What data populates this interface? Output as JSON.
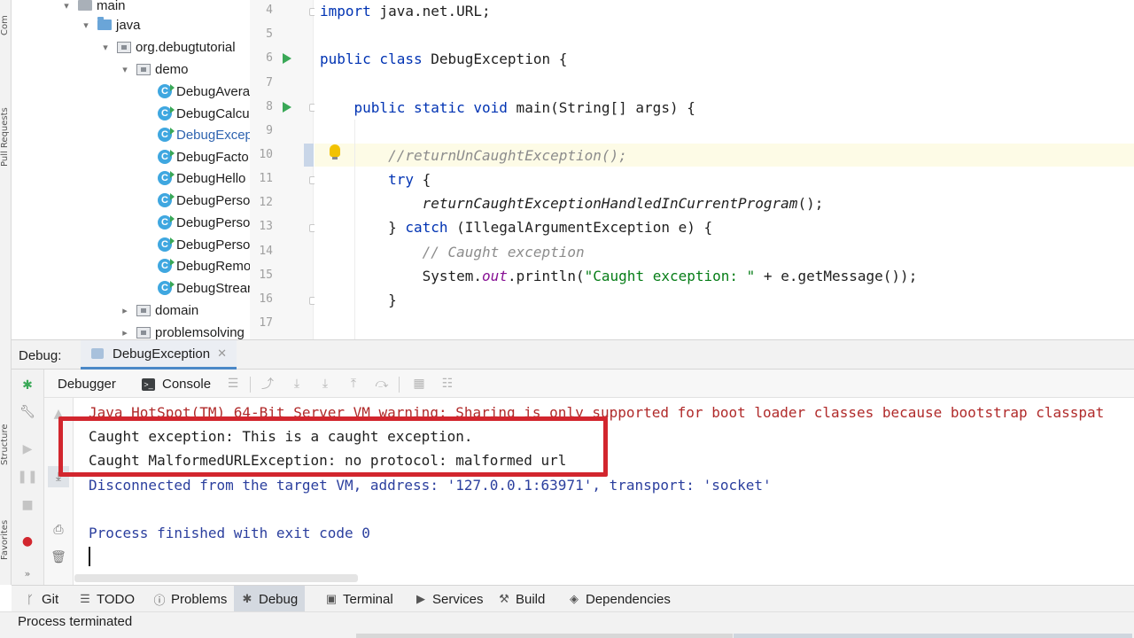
{
  "left_strip": {
    "labels": [
      "Com",
      "Pull Requests",
      "Structure",
      "Favorites"
    ]
  },
  "tree": {
    "items": [
      {
        "label": "main",
        "kind": "folder",
        "expanded": true,
        "selected": false
      },
      {
        "label": "java",
        "kind": "folder-blue",
        "expanded": true,
        "selected": false
      },
      {
        "label": "org.debugtutorial",
        "kind": "package",
        "expanded": true,
        "selected": false
      },
      {
        "label": "demo",
        "kind": "package",
        "expanded": true,
        "selected": false
      },
      {
        "label": "DebugAvera",
        "kind": "class",
        "selected": false
      },
      {
        "label": "DebugCalcu",
        "kind": "class",
        "selected": false
      },
      {
        "label": "DebugExcep",
        "kind": "class",
        "selected": true
      },
      {
        "label": "DebugFacto",
        "kind": "class",
        "selected": false
      },
      {
        "label": "DebugHello",
        "kind": "class",
        "selected": false
      },
      {
        "label": "DebugPerso",
        "kind": "class",
        "selected": false
      },
      {
        "label": "DebugPerso",
        "kind": "class",
        "selected": false
      },
      {
        "label": "DebugPerso",
        "kind": "class",
        "selected": false
      },
      {
        "label": "DebugRemo",
        "kind": "class",
        "selected": false
      },
      {
        "label": "DebugStrean",
        "kind": "class",
        "selected": false
      },
      {
        "label": "domain",
        "kind": "package",
        "expanded": false,
        "selected": false
      },
      {
        "label": "problemsolving",
        "kind": "package",
        "expanded": false,
        "selected": false
      }
    ]
  },
  "editor": {
    "line_numbers": [
      "4",
      "5",
      "6",
      "7",
      "8",
      "9",
      "10",
      "11",
      "12",
      "13",
      "14",
      "15",
      "16",
      "17"
    ],
    "current_line": "10",
    "run_marker_lines": [
      "6",
      "8"
    ],
    "lines": [
      {
        "num": "4",
        "text": "import java.net.URL;"
      },
      {
        "num": "5",
        "text": ""
      },
      {
        "num": "6",
        "text": "public class DebugException {"
      },
      {
        "num": "7",
        "text": ""
      },
      {
        "num": "8",
        "text": "    public static void main(String[] args) {"
      },
      {
        "num": "9",
        "text": ""
      },
      {
        "num": "10",
        "text": "        //returnUnCaughtException();"
      },
      {
        "num": "11",
        "text": "        try {"
      },
      {
        "num": "12",
        "text": "            returnCaughtExceptionHandledInCurrentProgram();"
      },
      {
        "num": "13",
        "text": "        } catch (IllegalArgumentException e) {"
      },
      {
        "num": "14",
        "text": "            // Caught exception"
      },
      {
        "num": "15",
        "text": "            System.out.println(\"Caught exception: \" + e.getMessage());"
      },
      {
        "num": "16",
        "text": "        }"
      },
      {
        "num": "17",
        "text": ""
      }
    ]
  },
  "debug": {
    "title": "Debug:",
    "tab_label": "DebugException",
    "subtabs": {
      "debugger": "Debugger",
      "console": "Console"
    },
    "console_lines": [
      {
        "text": "Java HotSpot(TM) 64-Bit Server VM warning: Sharing is only supported for boot loader classes because bootstrap classpat",
        "kind": "err"
      },
      {
        "text": "Caught exception: This is a caught exception.",
        "kind": "out"
      },
      {
        "text": "Caught MalformedURLException: no protocol: malformed url",
        "kind": "out"
      },
      {
        "text": "Disconnected from the target VM, address: '127.0.0.1:63971', transport: 'socket'",
        "kind": "sys"
      },
      {
        "text": "",
        "kind": "out"
      },
      {
        "text": "Process finished with exit code 0",
        "kind": "sys"
      }
    ]
  },
  "bottom_tabs": [
    {
      "label": "Git",
      "icon": "git-branch-icon"
    },
    {
      "label": "TODO",
      "icon": "todo-list-icon"
    },
    {
      "label": "Problems",
      "icon": "problems-icon"
    },
    {
      "label": "Debug",
      "icon": "bug-icon",
      "active": true
    },
    {
      "label": "Terminal",
      "icon": "terminal-icon"
    },
    {
      "label": "Services",
      "icon": "services-icon"
    },
    {
      "label": "Build",
      "icon": "hammer-icon"
    },
    {
      "label": "Dependencies",
      "icon": "layers-icon"
    }
  ],
  "status": {
    "text": "Process terminated"
  },
  "colors": {
    "accent": "#4a88c7",
    "highlight_box": "#d2262e",
    "keyword": "#0033b3",
    "string": "#067d17",
    "comment": "#8c8c8c",
    "console_error": "#b02a2a",
    "console_system": "#2b3f9e"
  }
}
